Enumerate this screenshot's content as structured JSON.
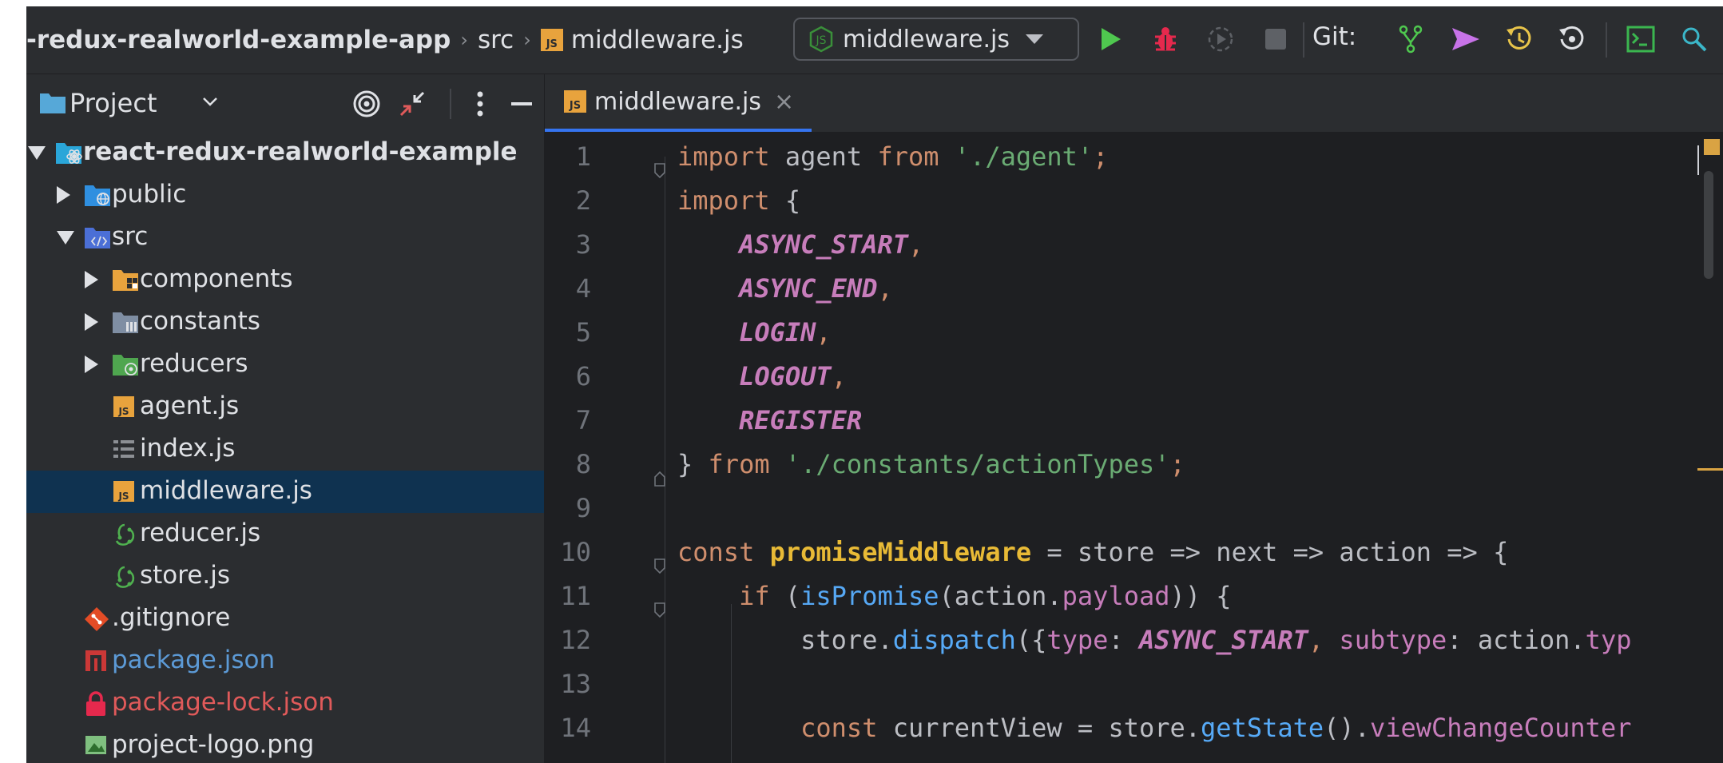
{
  "breadcrumb": {
    "project": "-redux-realworld-example-app",
    "folder": "src",
    "file": "middleware.js"
  },
  "run_config": {
    "label": "middleware.js"
  },
  "toolbar": {
    "git_label": "Git:"
  },
  "project_panel": {
    "title": "Project",
    "tree": [
      {
        "label": "react-redux-realworld-example",
        "depth": 0,
        "expanded": true,
        "icon": "react-project-folder-icon",
        "bold": true
      },
      {
        "label": "public",
        "depth": 1,
        "expanded": false,
        "icon": "web-folder-icon"
      },
      {
        "label": "src",
        "depth": 1,
        "expanded": true,
        "icon": "source-folder-icon"
      },
      {
        "label": "components",
        "depth": 2,
        "expanded": false,
        "icon": "components-folder-icon"
      },
      {
        "label": "constants",
        "depth": 2,
        "expanded": false,
        "icon": "constants-folder-icon"
      },
      {
        "label": "reducers",
        "depth": 2,
        "expanded": false,
        "icon": "reducers-folder-icon"
      },
      {
        "label": "agent.js",
        "depth": 2,
        "icon": "js-file-icon"
      },
      {
        "label": "index.js",
        "depth": 2,
        "icon": "index-file-icon"
      },
      {
        "label": "middleware.js",
        "depth": 2,
        "icon": "js-file-icon",
        "selected": true
      },
      {
        "label": "reducer.js",
        "depth": 2,
        "icon": "redux-file-icon"
      },
      {
        "label": "store.js",
        "depth": 2,
        "icon": "redux-file-icon"
      },
      {
        "label": ".gitignore",
        "depth": 1,
        "icon": "git-ignore-icon"
      },
      {
        "label": "package.json",
        "depth": 1,
        "icon": "npm-package-icon",
        "color": "#5c9ad6"
      },
      {
        "label": "package-lock.json",
        "depth": 1,
        "icon": "lock-icon",
        "color": "#e05a5a"
      },
      {
        "label": "project-logo.png",
        "depth": 1,
        "icon": "image-file-icon"
      }
    ]
  },
  "editor": {
    "tab": {
      "label": "middleware.js",
      "close": "×"
    },
    "lines": [
      {
        "n": "1",
        "tokens": [
          [
            "kw",
            "import"
          ],
          [
            "plain",
            " agent "
          ],
          [
            "kw",
            "from"
          ],
          [
            "plain",
            " "
          ],
          [
            "str",
            "'./agent'"
          ],
          [
            "kw",
            ";"
          ]
        ]
      },
      {
        "n": "2",
        "tokens": [
          [
            "kw",
            "import"
          ],
          [
            "plain",
            " {"
          ]
        ]
      },
      {
        "n": "3",
        "tokens": [
          [
            "plain",
            "    "
          ],
          [
            "const",
            "ASYNC_START"
          ],
          [
            "kw",
            ","
          ]
        ]
      },
      {
        "n": "4",
        "tokens": [
          [
            "plain",
            "    "
          ],
          [
            "const",
            "ASYNC_END"
          ],
          [
            "kw",
            ","
          ]
        ]
      },
      {
        "n": "5",
        "tokens": [
          [
            "plain",
            "    "
          ],
          [
            "const",
            "LOGIN"
          ],
          [
            "kw",
            ","
          ]
        ]
      },
      {
        "n": "6",
        "tokens": [
          [
            "plain",
            "    "
          ],
          [
            "const",
            "LOGOUT"
          ],
          [
            "kw",
            ","
          ]
        ]
      },
      {
        "n": "7",
        "tokens": [
          [
            "plain",
            "    "
          ],
          [
            "const",
            "REGISTER"
          ]
        ]
      },
      {
        "n": "8",
        "tokens": [
          [
            "plain",
            "} "
          ],
          [
            "kw",
            "from"
          ],
          [
            "plain",
            " "
          ],
          [
            "str",
            "'./constants/actionTypes'"
          ],
          [
            "kw",
            ";"
          ]
        ]
      },
      {
        "n": "9",
        "tokens": []
      },
      {
        "n": "10",
        "tokens": [
          [
            "kw",
            "const"
          ],
          [
            "plain",
            " "
          ],
          [
            "fn",
            "promiseMiddleware"
          ],
          [
            "plain",
            " = store => next => action => {"
          ]
        ]
      },
      {
        "n": "11",
        "tokens": [
          [
            "plain",
            "    "
          ],
          [
            "kw",
            "if"
          ],
          [
            "plain",
            " ("
          ],
          [
            "fncall",
            "isPromise"
          ],
          [
            "plain",
            "(action."
          ],
          [
            "prop",
            "payload"
          ],
          [
            "plain",
            ")) {"
          ]
        ]
      },
      {
        "n": "12",
        "tokens": [
          [
            "plain",
            "        store."
          ],
          [
            "method",
            "dispatch"
          ],
          [
            "plain",
            "({"
          ],
          [
            "prop",
            "type"
          ],
          [
            "plain",
            ": "
          ],
          [
            "const",
            "ASYNC_START"
          ],
          [
            "kw",
            ","
          ],
          [
            "plain",
            " "
          ],
          [
            "prop",
            "subtype"
          ],
          [
            "plain",
            ": action."
          ],
          [
            "prop",
            "typ"
          ]
        ]
      },
      {
        "n": "13",
        "tokens": []
      },
      {
        "n": "14",
        "tokens": [
          [
            "plain",
            "        "
          ],
          [
            "kw",
            "const"
          ],
          [
            "plain",
            " currentView = store."
          ],
          [
            "method",
            "getState"
          ],
          [
            "plain",
            "()."
          ],
          [
            "prop",
            "viewChangeCounter"
          ]
        ]
      }
    ]
  },
  "colors": {
    "accent": "#3574f0",
    "selection": "#0f3250",
    "keyword": "#cf8e6d",
    "string": "#6aab73",
    "constant": "#c77dbb",
    "function": "#e8ba36"
  }
}
